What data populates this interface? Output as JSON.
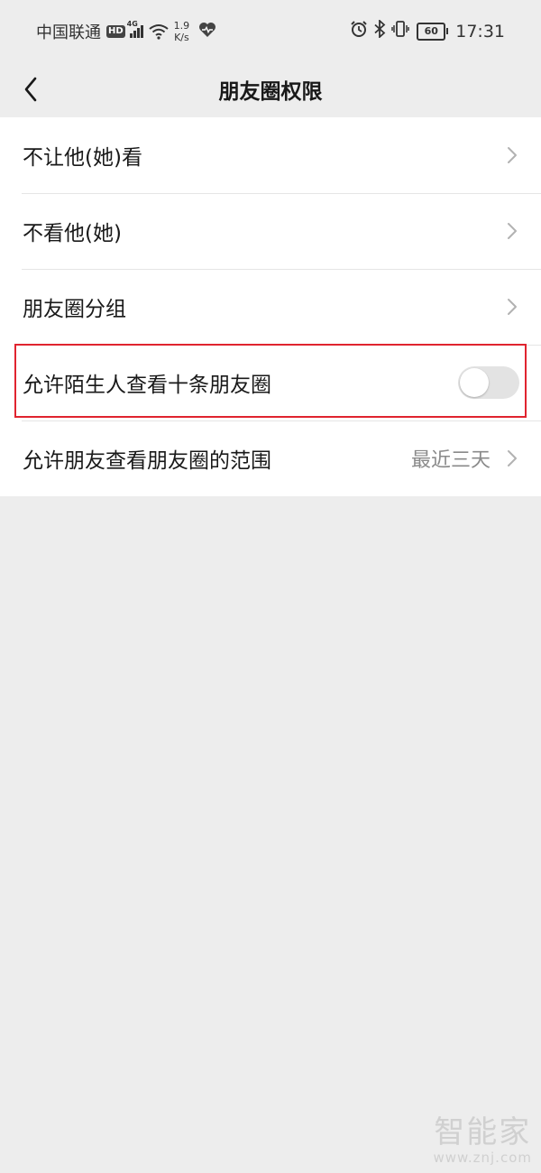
{
  "status_bar": {
    "carrier": "中国联通",
    "hd_badge": "HD",
    "network_type": "4G",
    "speed_value": "1.9",
    "speed_unit": "K/s",
    "battery_level": "60",
    "time": "17:31",
    "icons": [
      "signal-icon",
      "wifi-icon",
      "health-heart-icon",
      "alarm-icon",
      "bluetooth-icon",
      "vibrate-icon",
      "battery-icon"
    ]
  },
  "nav": {
    "title": "朋友圈权限",
    "back_icon": "chevron-left-icon"
  },
  "list": {
    "items": [
      {
        "label": "不让他(她)看"
      },
      {
        "label": "不看他(她)"
      },
      {
        "label": "朋友圈分组"
      },
      {
        "label": "允许陌生人查看十条朋友圈",
        "toggle_on": false
      },
      {
        "label": "允许朋友查看朋友圈的范围",
        "value": "最近三天"
      }
    ]
  },
  "colors": {
    "background": "#ededed",
    "highlight_border": "#e0242f",
    "toggle_off": "#e3e3e3",
    "secondary_text": "#8a8a8a"
  },
  "watermark": {
    "logo_text": "智能家",
    "url": "www.znj.com"
  }
}
